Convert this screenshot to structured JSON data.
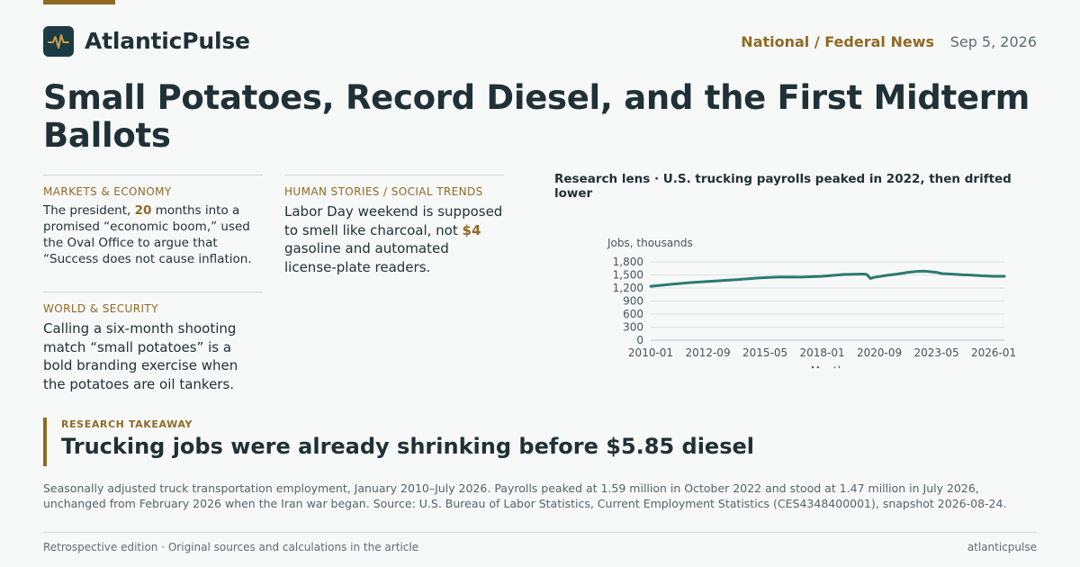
{
  "brand": {
    "name": "AtlanticPulse",
    "icon": "pulse-icon",
    "accent": "#8f6a24",
    "logo_bg": "#1d3b45"
  },
  "header": {
    "section": "National / Federal News",
    "date": "Sep 5, 2026"
  },
  "headline": "Small Potatoes, Record Diesel, and the First Midterm Ballots",
  "columns": {
    "markets": {
      "kicker": "MARKETS & ECONOMY",
      "text_before": "The president, ",
      "highlight": "20",
      "text_after": " months into a promised “economic boom,” used the Oval Office to argue that “Success does not cause inflation."
    },
    "human": {
      "kicker": "HUMAN STORIES / SOCIAL TRENDS",
      "text_before": "Labor Day weekend is supposed to smell like charcoal, not ",
      "highlight": "$4",
      "text_after": " gasoline and automated license-plate readers."
    },
    "world": {
      "kicker": "WORLD & SECURITY",
      "text": "Calling a six-month shooting match “small potatoes” is a bold branding exercise when the potatoes are oil tankers."
    }
  },
  "chart_data": {
    "type": "line",
    "title": "Research lens · U.S. trucking payrolls peaked in 2022, then drifted lower",
    "xlabel": "Month",
    "ylabel": "Jobs, thousands",
    "ylim": [
      0,
      1800
    ],
    "yticks": [
      0,
      300,
      600,
      900,
      1200,
      1500,
      1800
    ],
    "ytick_labels": [
      "0",
      "300",
      "600",
      "900",
      "1,200",
      "1,500",
      "1,800"
    ],
    "xticks": [
      "2010-01",
      "2012-09",
      "2015-05",
      "2018-01",
      "2020-09",
      "2023-05",
      "2026-01"
    ],
    "xrange": [
      "2010-01",
      "2026-07"
    ],
    "color": "#2a7a6e",
    "grid": true,
    "series": [
      {
        "x": [
          "2010-01",
          "2011-01",
          "2012-01",
          "2013-01",
          "2014-01",
          "2015-01",
          "2016-01",
          "2017-01",
          "2018-01",
          "2019-01",
          "2019-12",
          "2020-02",
          "2020-04",
          "2020-06",
          "2021-01",
          "2021-07",
          "2022-01",
          "2022-06",
          "2022-10",
          "2023-05",
          "2023-08",
          "2024-01",
          "2024-07",
          "2025-01",
          "2025-07",
          "2026-01",
          "2026-07"
        ],
        "y": [
          1240,
          1290,
          1330,
          1360,
          1390,
          1430,
          1455,
          1450,
          1470,
          1510,
          1520,
          1510,
          1420,
          1445,
          1490,
          1520,
          1560,
          1580,
          1590,
          1560,
          1530,
          1520,
          1505,
          1495,
          1480,
          1470,
          1470
        ]
      }
    ]
  },
  "takeaway": {
    "kicker": "RESEARCH TAKEAWAY",
    "title": "Trucking jobs were already shrinking before $5.85 diesel"
  },
  "footnote": "Seasonally adjusted truck transportation employment, January 2010–July 2026. Payrolls peaked at 1.59 million in October 2022 and stood at 1.47 million in July 2026, unchanged from February 2026 when the Iran war began. Source: U.S. Bureau of Labor Statistics, Current Employment Statistics (CES4348400001), snapshot 2026-08-24.",
  "footer": {
    "left": "Retrospective edition · Original sources and calculations in the article",
    "right": "atlanticpulse"
  }
}
